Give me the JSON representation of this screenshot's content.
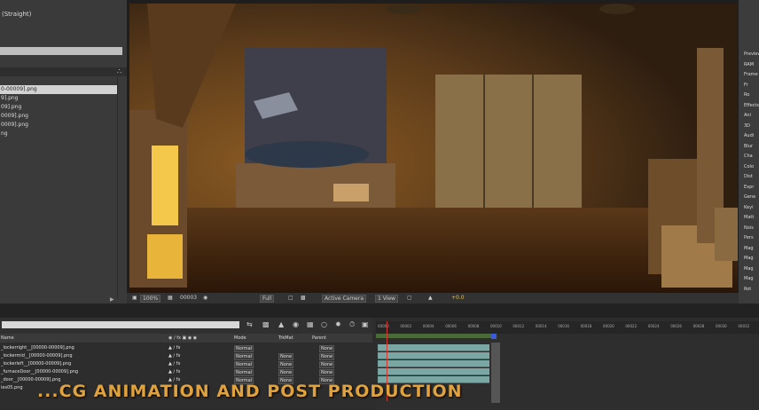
{
  "project": {
    "info_line": "(Straight)",
    "files": [
      "0-00009].png",
      "9].png",
      "09].png",
      "0009].png",
      "0009].png",
      "ng"
    ]
  },
  "viewer": {
    "zoom": "100%",
    "timecode": "00003",
    "resolution": "Full",
    "camera": "Active Camera",
    "view": "1 View",
    "exposure": "+0.0"
  },
  "right_panel": {
    "items": [
      "Preview",
      "RAM",
      "Frame",
      "Fr",
      "Ro",
      "Effects",
      "Ani",
      "3D",
      "Audi",
      "Blur",
      "Cha",
      "Colo",
      "Dist",
      "Expr",
      "Gene",
      "Keyi",
      "Matt",
      "Nois",
      "Pers",
      "Mag",
      "Mag",
      "Mag",
      "Mag",
      "Rot"
    ]
  },
  "timeline": {
    "columns": {
      "name": "Name",
      "mode": "Mode",
      "trkmat": "TrkMat",
      "parent": "Parent"
    },
    "layers": [
      {
        "name": "_lockerright__[00000-00009].png",
        "mode": "Normal",
        "trkmat": "",
        "parent": "None"
      },
      {
        "name": "_lockermid__[00000-00009].png",
        "mode": "Normal",
        "trkmat": "None",
        "parent": "None"
      },
      {
        "name": "_lockerleft__[00000-00009].png",
        "mode": "Normal",
        "trkmat": "None",
        "parent": "None"
      },
      {
        "name": "_furnaceDoor__[00000-00009].png",
        "mode": "Normal",
        "trkmat": "None",
        "parent": "None"
      },
      {
        "name": "_door__[00000-00009].png",
        "mode": "Normal",
        "trkmat": "None",
        "parent": "None"
      },
      {
        "name": "ies05.png",
        "mode": "",
        "trkmat": "",
        "parent": ""
      }
    ],
    "ruler_ticks": [
      "00000",
      "00002",
      "00004",
      "00006",
      "00008",
      "00010",
      "00012",
      "00014",
      "00016",
      "00018",
      "00020",
      "00022",
      "00024",
      "00026",
      "00028",
      "00030",
      "00032"
    ]
  },
  "overlay_title": "...CG ANIMATION AND POST PRODUCTION",
  "colors": {
    "accent": "#e0a23d",
    "track": "#7aa6a3",
    "playhead": "#d23b2f"
  }
}
